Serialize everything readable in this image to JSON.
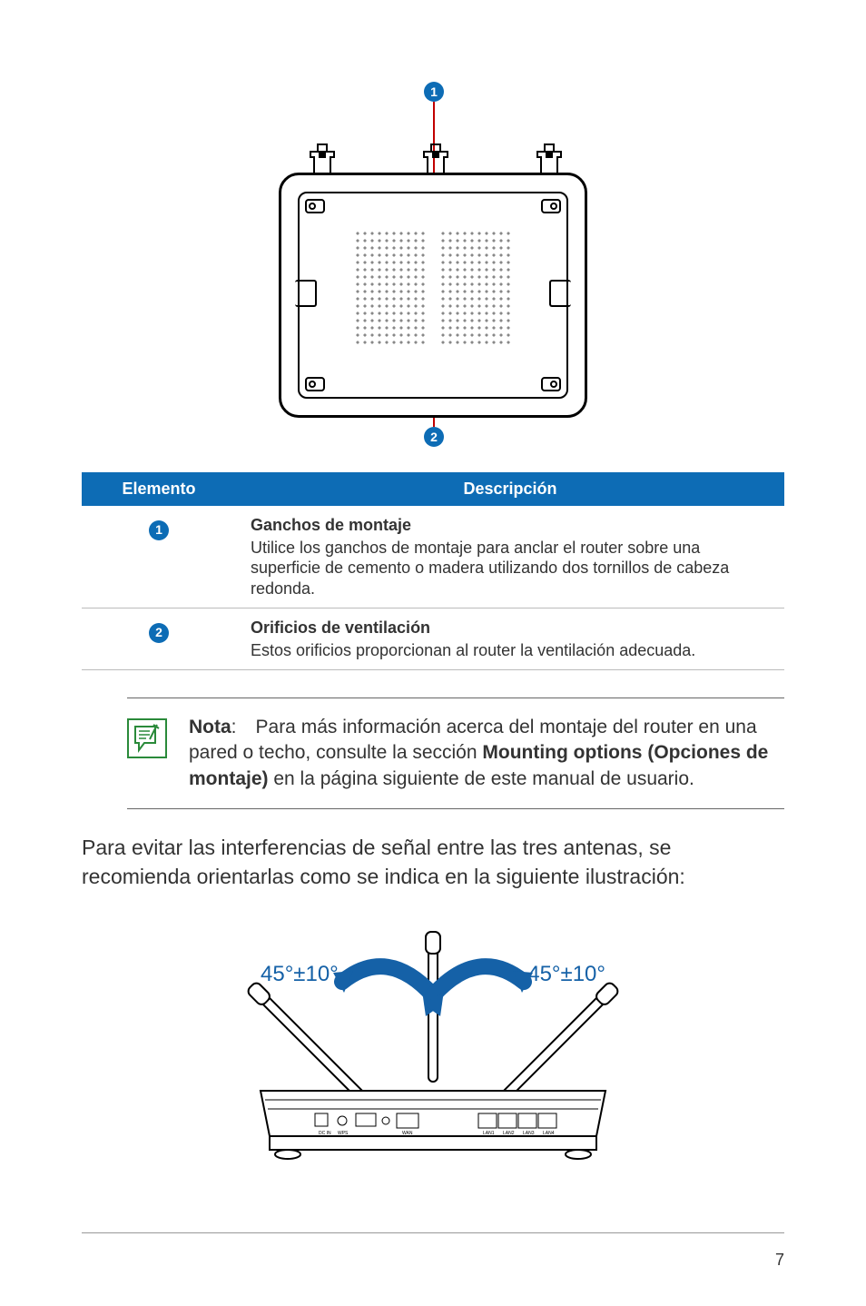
{
  "callouts": {
    "one": "1",
    "two": "2"
  },
  "table": {
    "header_item": "Elemento",
    "header_desc": "Descripción",
    "row1": {
      "title": "Ganchos de montaje",
      "desc": "Utilice los ganchos de montaje para anclar el router sobre una superficie de cemento o madera utilizando dos tornillos de cabeza redonda."
    },
    "row2": {
      "title": "Orificios de ventilación",
      "desc": "Estos orificios proporcionan al router la ventilación adecuada."
    }
  },
  "note": {
    "label": "Nota",
    "text_before": ": Para más información acerca del montaje del router en una pared o techo, consulte la sección ",
    "bold": "Mounting options (Opciones de montaje)",
    "text_after": " en la página siguiente de este manual de usuario."
  },
  "main_text": "Para evitar las interferencias de señal entre las tres antenas, se recomienda orientarlas como se indica en la siguiente ilustración:",
  "angle_label_left": "45°±10°",
  "angle_label_right": "45°±10°",
  "page_number": "7"
}
